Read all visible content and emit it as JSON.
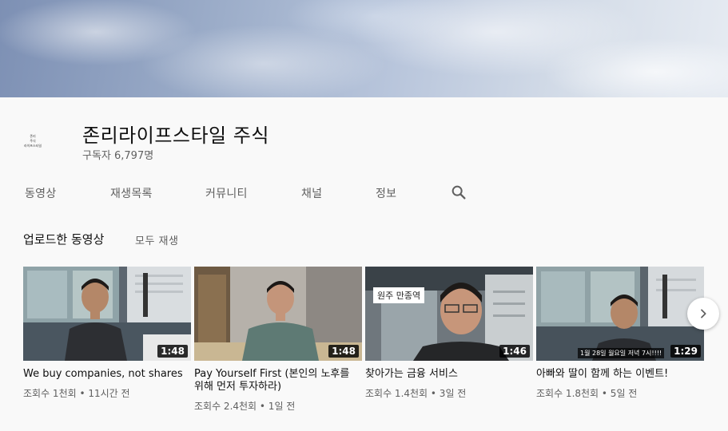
{
  "channel": {
    "name": "존리라이프스타일 주식",
    "subscribers": "구독자 6,797명",
    "avatar_lines": [
      "존리",
      "주식",
      "라이프스타일"
    ]
  },
  "tabs": [
    {
      "label": "동영상"
    },
    {
      "label": "재생목록"
    },
    {
      "label": "커뮤니티"
    },
    {
      "label": "채널"
    },
    {
      "label": "정보"
    }
  ],
  "section": {
    "title": "업로드한 동영상",
    "play_all": "모두 재생"
  },
  "videos": [
    {
      "title": "We buy companies, not shares",
      "duration": "1:48",
      "meta": "조회수 1천회 • 11시간 전"
    },
    {
      "title": "Pay Yourself First (본인의 노후를 위해 먼저 투자하라)",
      "duration": "1:48",
      "meta": "조회수 2.4천회 • 1일 전"
    },
    {
      "title": "찾아가는 금융 서비스",
      "duration": "1:46",
      "meta": "조회수 1.4천회 • 3일 전",
      "overlay_tag": "원주 만종역"
    },
    {
      "title": "아빠와 딸이 함께 하는 이벤트!",
      "duration": "1:29",
      "meta": "조회수 1.8천회 • 5일 전",
      "overlay_caption": "1월 28일 월요일 저녁 7시!!!!"
    }
  ],
  "icons": {
    "search": "search-icon",
    "next": "chevron-right-icon"
  }
}
